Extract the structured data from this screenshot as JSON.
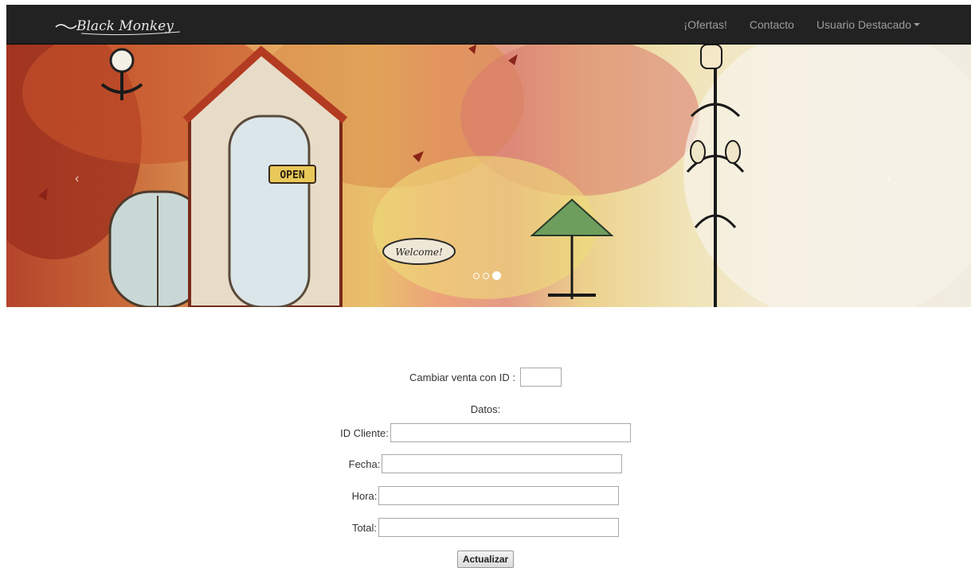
{
  "brand": {
    "logo_text": "Black Monkey"
  },
  "nav": {
    "items": [
      {
        "label": "¡Ofertas!"
      },
      {
        "label": "Contacto"
      },
      {
        "label": "Usuario Destacado"
      }
    ]
  },
  "carousel": {
    "sign_open": "OPEN",
    "sign_welcome": "Welcome!",
    "prev_icon": "chevron-left-icon",
    "next_icon": "chevron-right-icon",
    "indicator_count": 3,
    "active_indicator": 3
  },
  "form": {
    "change_label": "Cambiar venta con ID :",
    "change_value": "",
    "datos_label": "Datos:",
    "fields": [
      {
        "label": "ID Cliente:",
        "value": ""
      },
      {
        "label": "Fecha:",
        "value": ""
      },
      {
        "label": "Hora:",
        "value": ""
      },
      {
        "label": "Total:",
        "value": ""
      }
    ],
    "submit_label": "Actualizar"
  },
  "colors": {
    "navbar_bg": "#222222",
    "nav_text": "#9d9d9d",
    "page_bg": "#ffffff"
  }
}
